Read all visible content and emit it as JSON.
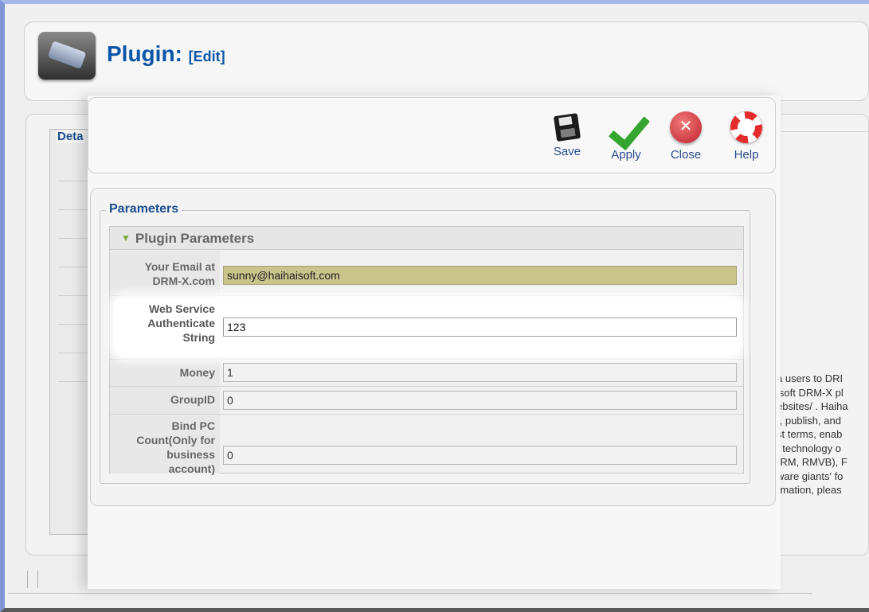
{
  "header": {
    "title": "Plugin:",
    "subtitle": "[Edit]"
  },
  "background": {
    "details_legend": "Deta",
    "description_lines": [
      "a users to DRI",
      "isoft DRM-X pl",
      "ebsites/ . Haiha",
      "t, publish, and",
      "st terms, enab",
      "/ technology o",
      "(RM, RMVB), F",
      "ware giants' fo",
      "rmation, pleas"
    ]
  },
  "toolbar": {
    "save_label": "Save",
    "apply_label": "Apply",
    "close_label": "Close",
    "help_label": "Help"
  },
  "params": {
    "legend": "Parameters",
    "panel_title": "Plugin Parameters",
    "email": {
      "label_1": "Your Email at",
      "label_2": "DRM-X.com",
      "value": "sunny@haihaisoft.com"
    },
    "auth": {
      "label_1": "Web Service",
      "label_2": "Authenticate",
      "label_3": "String",
      "value": "123"
    },
    "money": {
      "label": "Money",
      "value": "1"
    },
    "group": {
      "label": "GroupID",
      "value": "0"
    },
    "bindpc": {
      "label_1": "Bind PC",
      "label_2": "Count(Only for",
      "label_3": "business",
      "label_4": "account)",
      "value": "0"
    }
  }
}
